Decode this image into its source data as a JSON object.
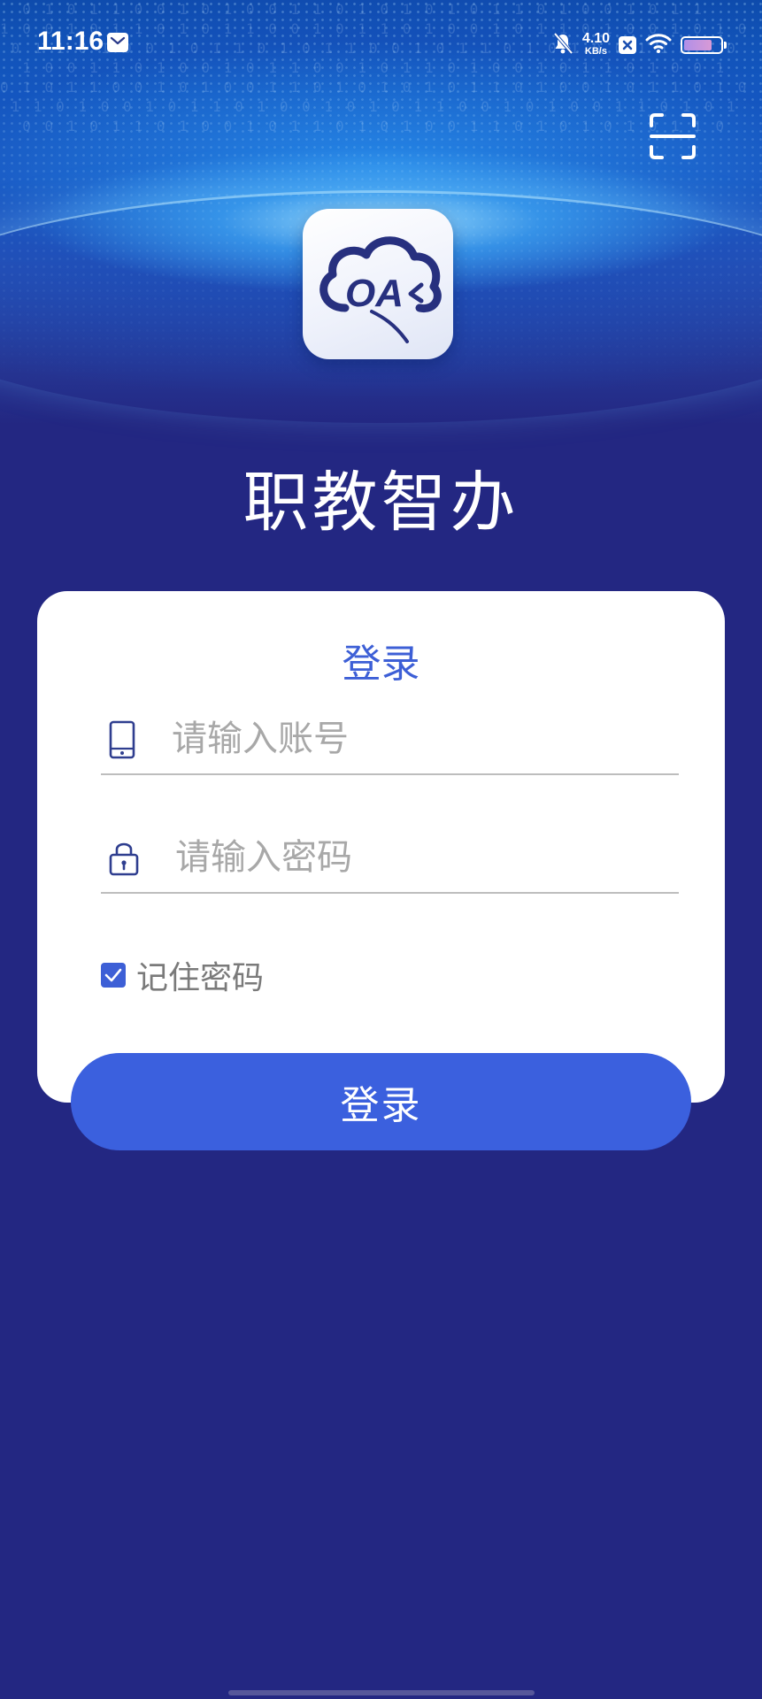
{
  "status_bar": {
    "time": "11:16",
    "net_speed_value": "4.10",
    "net_speed_unit": "KB/s",
    "icons": [
      "mail-icon",
      "bell-muted-icon",
      "close-app-icon",
      "wifi-icon",
      "battery-icon"
    ]
  },
  "header": {
    "scan_icon": "scan-icon",
    "logo_text": "OA",
    "app_title": "职教智办"
  },
  "login": {
    "card_title": "登录",
    "account_placeholder": "请输入账号",
    "account_value": "",
    "password_placeholder": "请输入密码",
    "password_value": "",
    "remember_label": "记住密码",
    "remember_checked": true,
    "submit_label": "登录"
  },
  "colors": {
    "background": "#232782",
    "accent": "#3b60de",
    "card": "#ffffff",
    "placeholder": "#a8a8a8"
  }
}
